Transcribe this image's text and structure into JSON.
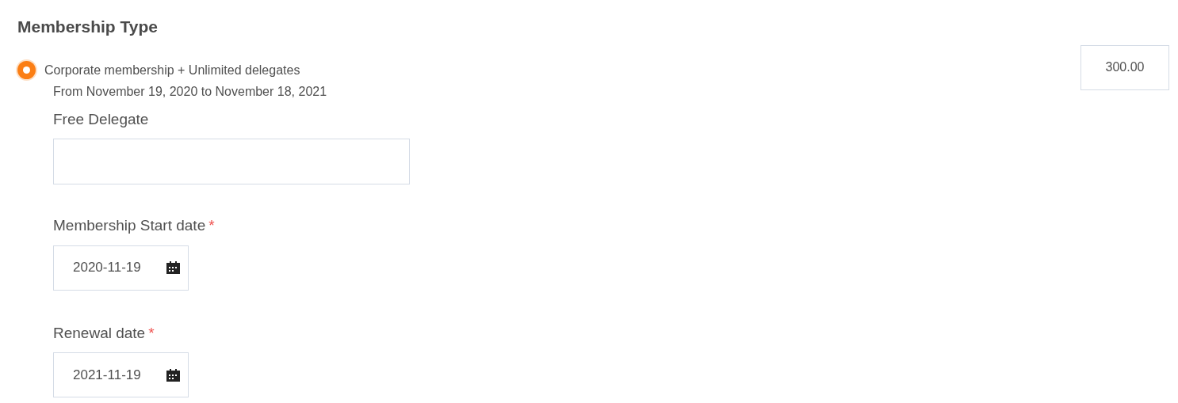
{
  "section_title": "Membership Type",
  "options": [
    {
      "label": "Corporate membership + Unlimited delegates",
      "selected": true,
      "price": "300.00",
      "period": "From November 19, 2020 to November 18, 2021"
    }
  ],
  "fields": [
    {
      "kind": "text",
      "label": "Free Delegate"
    },
    {
      "kind": "date",
      "label": "Membership Start date",
      "required_mark": "*",
      "value": "2020-11-19"
    },
    {
      "kind": "date",
      "label": "Renewal date",
      "required_mark": "*",
      "value": "2021-11-19"
    }
  ]
}
